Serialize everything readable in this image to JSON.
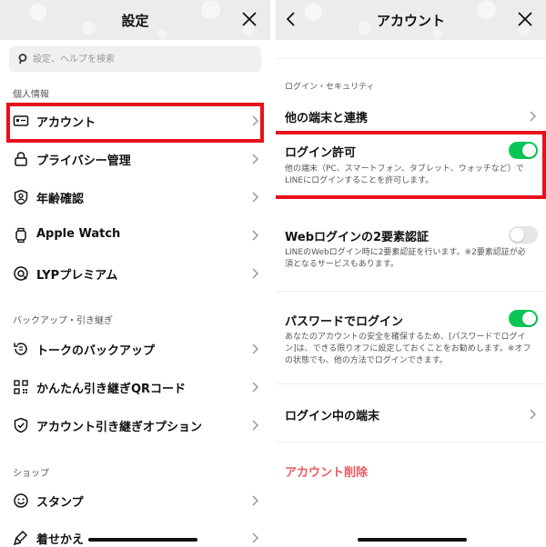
{
  "left": {
    "title": "設定",
    "search_placeholder": "設定、ヘルプを検索",
    "sections": {
      "personal": "個人情報",
      "backup": "バックアップ・引き継ぎ",
      "shop": "ショップ"
    },
    "items": {
      "account": "アカウント",
      "privacy": "プライバシー管理",
      "age": "年齢確認",
      "apple_watch": "Apple Watch",
      "lyp": "LYPプレミアム",
      "talk_backup": "トークのバックアップ",
      "qr_transfer": "かんたん引き継ぎQRコード",
      "transfer_option": "アカウント引き継ぎオプション",
      "stamp": "スタンプ",
      "theme": "着せかえ"
    }
  },
  "right": {
    "title": "アカウント",
    "section": "ログイン・セキュリティ",
    "link_devices": "他の端末と連携",
    "login_allow": {
      "title": "ログイン許可",
      "desc": "他の端末（PC、スマートフォン、タブレット、ウォッチなど）でLINEにログインすることを許可します。",
      "enabled": true
    },
    "web_2fa": {
      "title": "Webログインの2要素認証",
      "desc": "LINEのWebログイン時に2要素認証を行います。※2要素認証が必須となるサービスもあります。",
      "enabled": false
    },
    "password_login": {
      "title": "パスワードでログイン",
      "desc": "あなたのアカウントの安全を確保するため、[パスワードでログイン]は、できる限りオフに設定しておくことをお勧めします。※オフの状態でも、他の方法でログインできます。",
      "enabled": true
    },
    "logged_in_devices": "ログイン中の端末",
    "delete_account": "アカウント削除"
  },
  "colors": {
    "accent_green": "#06c755",
    "highlight_red": "#e8101a",
    "danger": "#e85b63"
  }
}
